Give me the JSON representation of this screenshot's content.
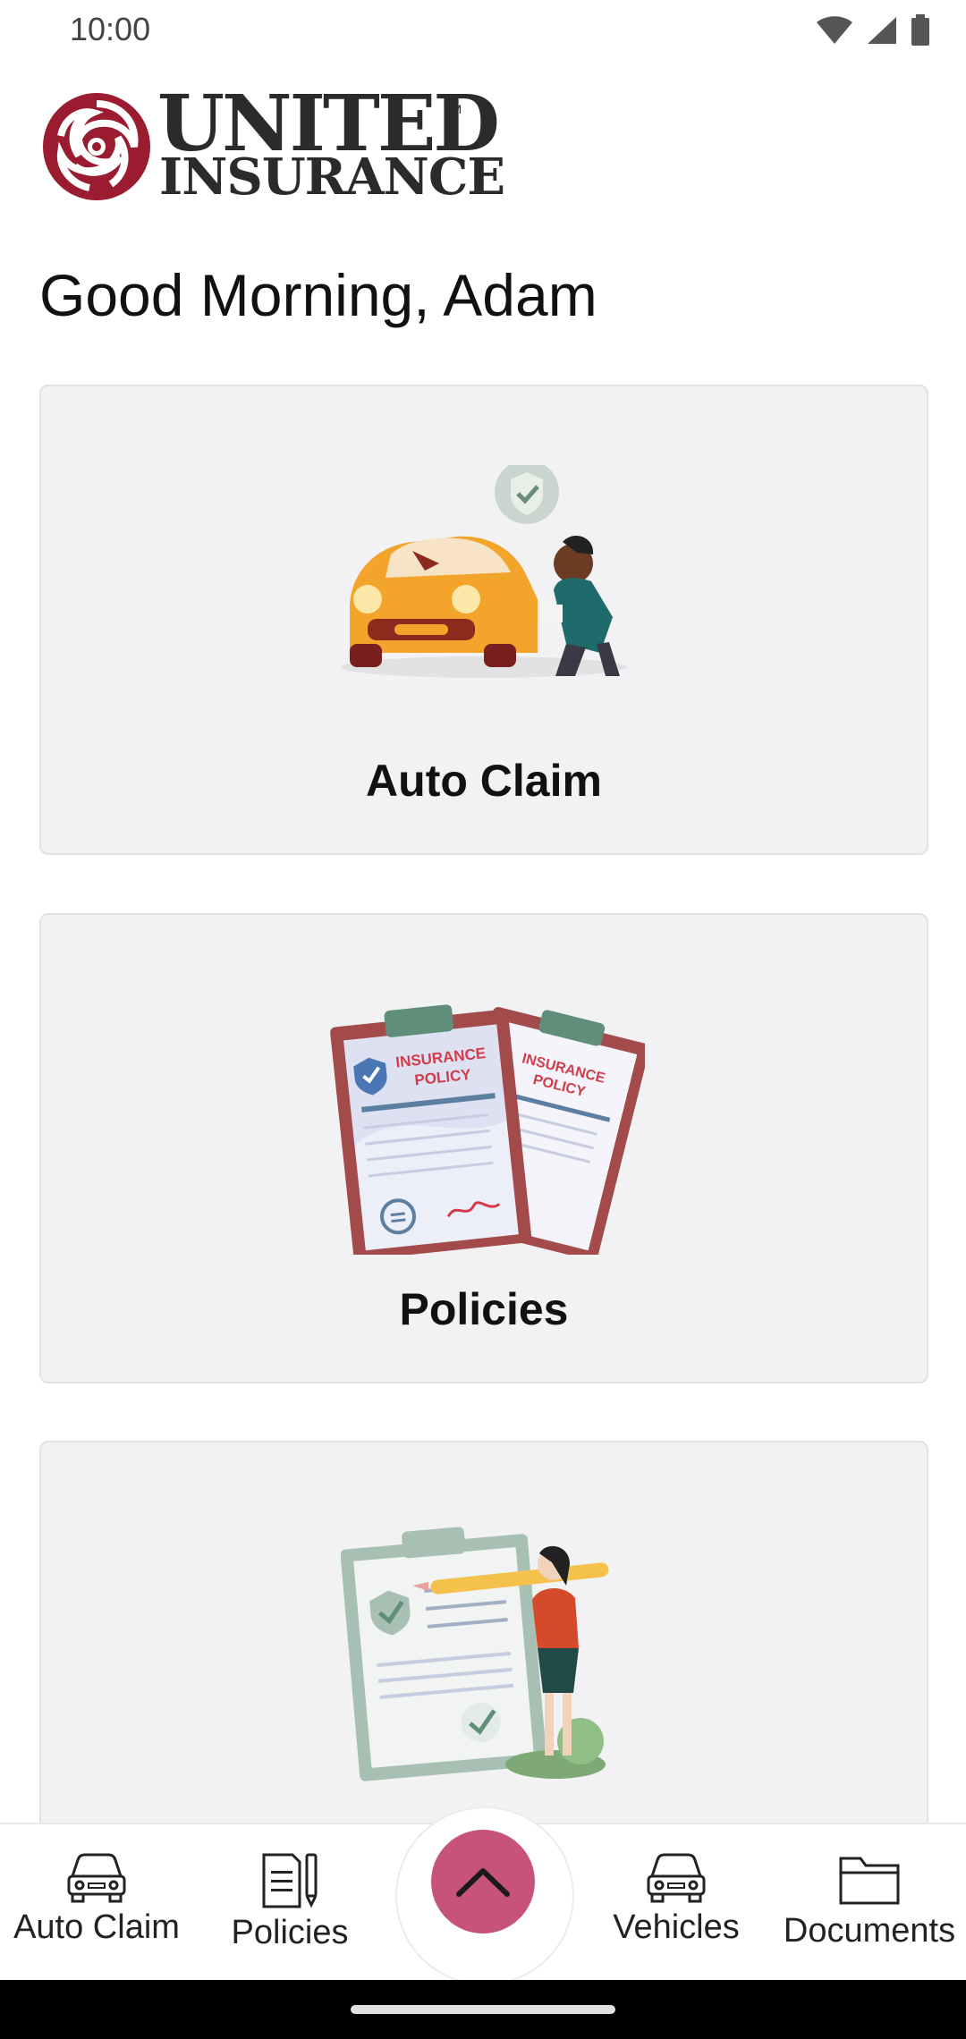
{
  "status_bar": {
    "time": "10:00",
    "icons": [
      "wifi-icon",
      "signal-icon",
      "battery-icon"
    ]
  },
  "logo": {
    "line1": "UNITED",
    "line2": "INSURANCE",
    "tm": "TM",
    "brand_color": "#9b1b30"
  },
  "greeting": "Good Morning, Adam",
  "cards": [
    {
      "title": "Auto Claim",
      "illustration": "car-inspection-illustration"
    },
    {
      "title": "Policies",
      "illustration": "insurance-policy-illustration"
    },
    {
      "title": "",
      "illustration": "checklist-illustration"
    }
  ],
  "bottom_nav": {
    "items": [
      {
        "label": "Auto Claim",
        "icon": "car-icon"
      },
      {
        "label": "Policies",
        "icon": "document-pen-icon"
      },
      {
        "label": "Vehicles",
        "icon": "car-icon"
      },
      {
        "label": "Documents",
        "icon": "folder-icon"
      }
    ],
    "fab_icon": "chevron-up-icon",
    "fab_color": "#c7527a"
  }
}
